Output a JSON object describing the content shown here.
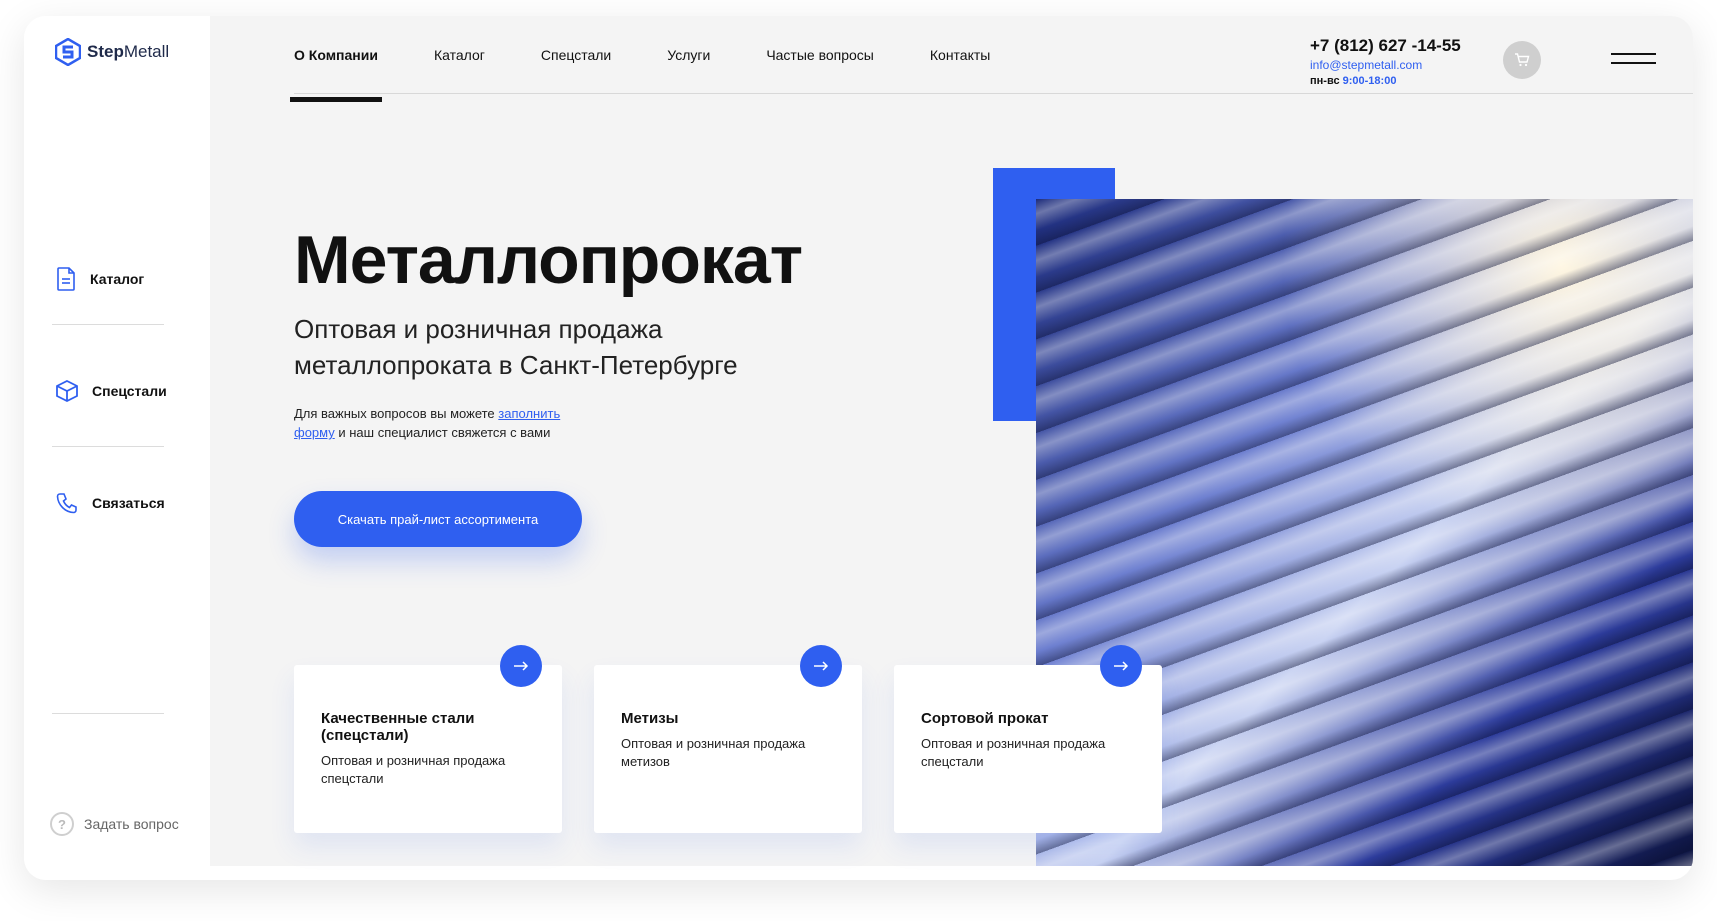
{
  "brand": {
    "logo_strong": "Step",
    "logo_light": "Metall"
  },
  "sidebar": {
    "items": [
      {
        "label": "Каталог",
        "icon": "document-icon"
      },
      {
        "label": "Спецстали",
        "icon": "cube-icon"
      },
      {
        "label": "Связаться",
        "icon": "phone-icon"
      }
    ],
    "ask_label": "Задать вопрос"
  },
  "nav": {
    "items": [
      "О Компании",
      "Каталог",
      "Спецстали",
      "Услуги",
      "Частые вопросы",
      "Контакты"
    ],
    "active_index": 0
  },
  "contact": {
    "phone": "+7 (812) 627 -14-55",
    "email": "info@stepmetall.com",
    "hours_label": "пн-вс",
    "hours_value": "9:00-18:00"
  },
  "hero": {
    "title": "Металлопрокат",
    "subtitle": "Оптовая и розничная продажа металлопроката в Санкт-Петербурге",
    "note_before": "Для важных вопросов вы можете",
    "note_link": "заполнить форму",
    "note_after": "и наш специалист свяжется с вами",
    "cta_label": "Скачать прай-лист ассортимента"
  },
  "cards": [
    {
      "title": "Качественные стали (спецстали)",
      "text": "Оптовая и розничная продажа спецстали"
    },
    {
      "title": "Метизы",
      "text": "Оптовая и розничная продажа метизов"
    },
    {
      "title": "Сортовой прокат",
      "text": "Оптовая и розничная продажа спецстали"
    }
  ],
  "colors": {
    "accent": "#2f5ff0",
    "background": "#f4f4f4",
    "text": "#111111"
  }
}
